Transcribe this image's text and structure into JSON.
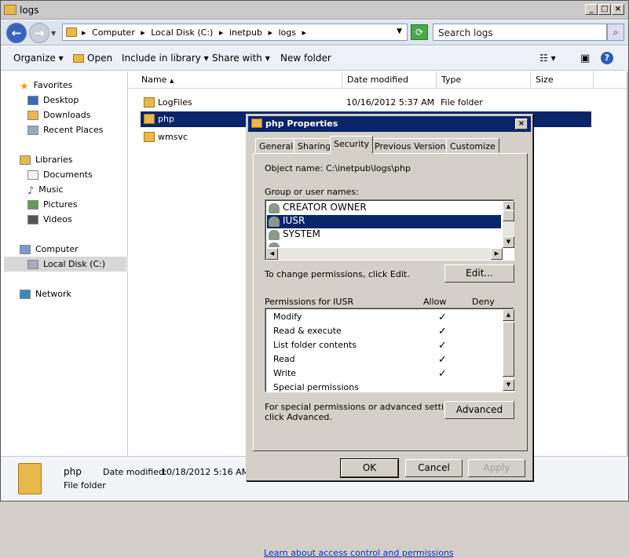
{
  "window": {
    "title": "logs"
  },
  "address": {
    "crumbs": [
      "Computer",
      "Local Disk (C:)",
      "inetpub",
      "logs"
    ],
    "search_placeholder": "Search logs"
  },
  "toolbar": {
    "organize": "Organize",
    "open": "Open",
    "include": "Include in library",
    "share": "Share with",
    "new_folder": "New folder"
  },
  "nav": {
    "favorites": "Favorites",
    "desktop": "Desktop",
    "downloads": "Downloads",
    "recent": "Recent Places",
    "libraries": "Libraries",
    "documents": "Documents",
    "music": "Music",
    "pictures": "Pictures",
    "videos": "Videos",
    "computer": "Computer",
    "localdisk": "Local Disk (C:)",
    "network": "Network"
  },
  "columns": {
    "name": "Name",
    "date": "Date modified",
    "type": "Type",
    "size": "Size"
  },
  "files": [
    {
      "name": "LogFiles",
      "date": "10/16/2012 5:37 AM",
      "type": "File folder"
    },
    {
      "name": "php",
      "date": "",
      "type": ""
    },
    {
      "name": "wmsvc",
      "date": "",
      "type": ""
    }
  ],
  "details": {
    "name": "php",
    "date_label": "Date modified:",
    "date": "10/18/2012 5:16 AM",
    "type": "File folder"
  },
  "dialog": {
    "title": "php Properties",
    "tabs": [
      "General",
      "Sharing",
      "Security",
      "Previous Versions",
      "Customize"
    ],
    "object_label": "Object name:",
    "object_value": "C:\\inetpub\\logs\\php",
    "group_label": "Group or user names:",
    "users": [
      "CREATOR OWNER",
      "IUSR",
      "SYSTEM"
    ],
    "change_text": "To change permissions, click Edit.",
    "edit": "Edit...",
    "perm_label": "Permissions for IUSR",
    "allow": "Allow",
    "deny": "Deny",
    "permissions": [
      {
        "name": "Modify",
        "allow": "✓"
      },
      {
        "name": "Read & execute",
        "allow": "✓"
      },
      {
        "name": "List folder contents",
        "allow": "✓"
      },
      {
        "name": "Read",
        "allow": "✓"
      },
      {
        "name": "Write",
        "allow": "✓"
      },
      {
        "name": "Special permissions",
        "allow": ""
      }
    ],
    "special_text1": "For special permissions or advanced settings,",
    "special_text2": "click Advanced.",
    "advanced": "Advanced",
    "link": "Learn about access control and permissions",
    "ok": "OK",
    "cancel": "Cancel",
    "apply": "Apply"
  }
}
